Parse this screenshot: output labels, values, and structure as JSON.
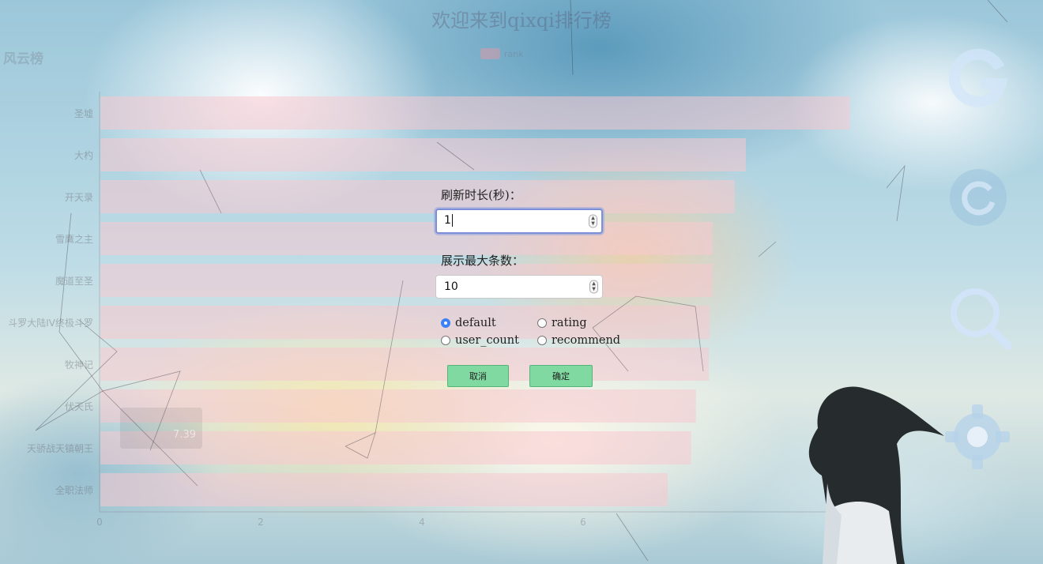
{
  "page": {
    "title": "欢迎来到qixqi排行榜"
  },
  "chart_data": {
    "type": "bar",
    "orientation": "horizontal",
    "title": "风云榜",
    "legend": [
      "rank"
    ],
    "legend_position": "top-center",
    "categories": [
      "圣墟",
      "大杓",
      "开天录",
      "雪鹰之主",
      "魔道至圣",
      "斗罗大陆IV终极斗罗",
      "牧神记",
      "伏天氏",
      "天骄战天镇朝王",
      "全职法师"
    ],
    "series": [
      {
        "name": "rank",
        "values": [
          9.3,
          8.01,
          7.87,
          7.6,
          7.6,
          7.56,
          7.55,
          7.39,
          7.33,
          7.04
        ]
      }
    ],
    "xlim": [
      0,
      9.5
    ],
    "xticks": [
      "0",
      "2",
      "4",
      "6"
    ],
    "grid": false,
    "tooltip_value": "7.39",
    "colors": {
      "bar": "#f7c9cf"
    }
  },
  "dialog": {
    "refresh_label": "刷新时长(秒)：",
    "refresh_value": "1",
    "max_label": "展示最大条数：",
    "max_value": "10",
    "sort_options": [
      "default",
      "rating",
      "user_count",
      "recommend"
    ],
    "selected_option": "default",
    "cancel_label": "取消",
    "confirm_label": "确定"
  },
  "side_icons": [
    "google-icon",
    "refresh-icon",
    "search-icon",
    "settings-icon"
  ],
  "colors": {
    "accent": "#3b82f6",
    "button": "#7fd9a0",
    "focus": "#7b8fd6"
  }
}
